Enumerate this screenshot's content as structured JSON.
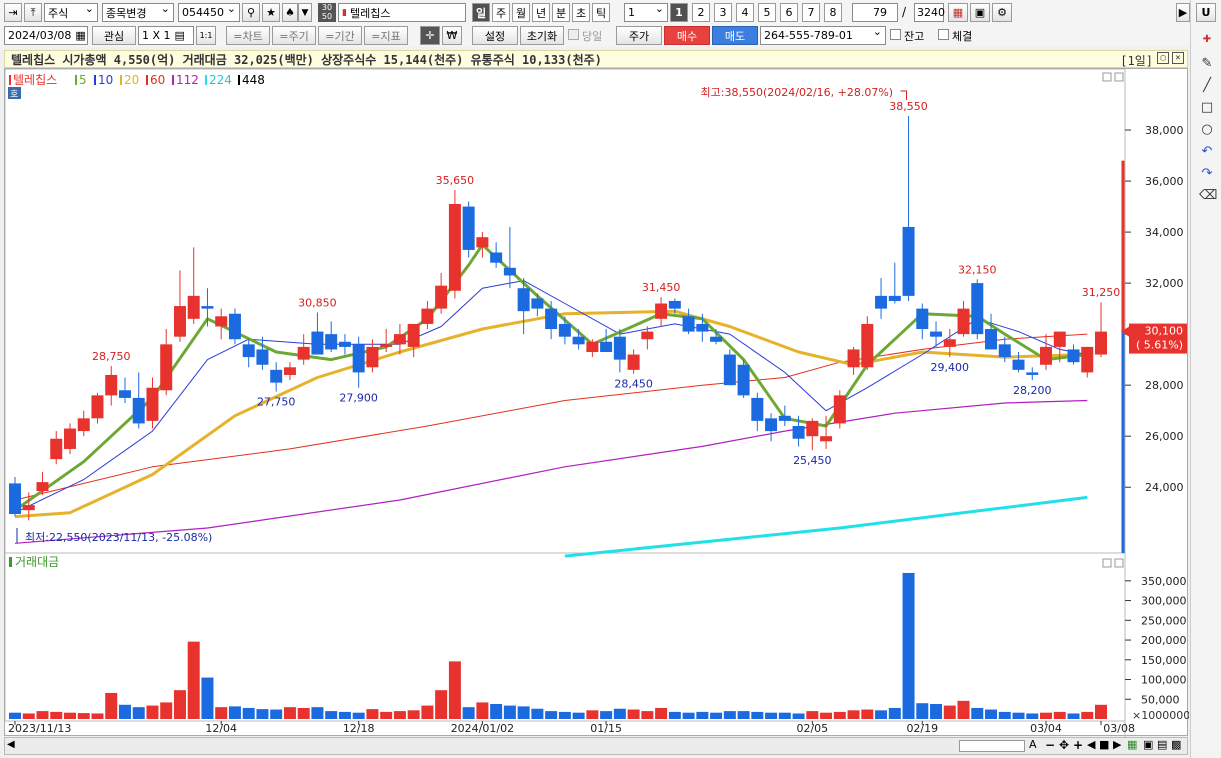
{
  "toolbar1": {
    "market": "주식",
    "change_label": "종목변경",
    "code": "054450",
    "stock_name": "텔레칩스",
    "period_buttons": [
      "일",
      "주",
      "월",
      "년",
      "분",
      "초",
      "틱"
    ],
    "interval_value": "1",
    "num_buttons": [
      "1",
      "2",
      "3",
      "4",
      "5",
      "6",
      "7",
      "8"
    ],
    "view_count": "79",
    "slash": "/",
    "total_count": "3240",
    "code_badge": "30\n50"
  },
  "toolbar2": {
    "date": "2024/03/08",
    "watch_label": "관심",
    "layout_label": "1 X 1",
    "chart_label": "=차트",
    "cycle_label": "=주기",
    "range_label": "=기간",
    "indicator_label": "=지표",
    "settings_label": "설정",
    "reset_label": "초기화",
    "today_label": "당일",
    "price_label": "주가",
    "buy_label": "매수",
    "sell_label": "매도",
    "account": "264-555-789-01",
    "balance_label": "잔고",
    "fill_label": "체결",
    "won_label": "₩"
  },
  "info_bar": {
    "text": "텔레칩스  시가총액 4,550(억)  거래대금 32,025(백만)  상장주식수 15,144(천주)  유통주식 10,133(천주)",
    "window_label": "[1일]"
  },
  "legend": {
    "name": "텔레칩스",
    "items": [
      {
        "label": "5",
        "color": "#6ea834"
      },
      {
        "label": "10",
        "color": "#2a3ad8"
      },
      {
        "label": "20",
        "color": "#e6b22a"
      },
      {
        "label": "60",
        "color": "#e0301e"
      },
      {
        "label": "112",
        "color": "#b020c0"
      },
      {
        "label": "224",
        "color": "#20e0e8"
      },
      {
        "label": "448",
        "color": "#000000"
      }
    ],
    "small_tag": "호"
  },
  "annotations": {
    "high": "최고:38,550(2024/02/16, +28.07%)",
    "low": "최저:22,550(2023/11/13, -25.08%)",
    "current_price": "30,100",
    "current_change": "( 5.61%)",
    "volume_title": "거래대금",
    "volume_unit": "×1000000"
  },
  "chart_data": {
    "type": "candlestick",
    "candles": [
      {
        "d": "2023/11/13",
        "o": 24150,
        "h": 24400,
        "l": 22850,
        "c": 22950
      },
      {
        "d": "2023/11/14",
        "o": 23100,
        "h": 23800,
        "l": 22700,
        "c": 23300
      },
      {
        "d": "2023/11/15",
        "o": 23850,
        "h": 24600,
        "l": 23700,
        "c": 24200
      },
      {
        "d": "2023/11/16",
        "o": 25100,
        "h": 26200,
        "l": 24900,
        "c": 25900
      },
      {
        "d": "2023/11/17",
        "o": 25500,
        "h": 26500,
        "l": 25300,
        "c": 26300
      },
      {
        "d": "2023/11/20",
        "o": 26200,
        "h": 27000,
        "l": 26000,
        "c": 26700
      },
      {
        "d": "2023/11/21",
        "o": 26700,
        "h": 27700,
        "l": 26500,
        "c": 27600
      },
      {
        "d": "2023/11/22",
        "o": 27600,
        "h": 28750,
        "l": 27200,
        "c": 28400
      },
      {
        "d": "2023/11/23",
        "o": 27800,
        "h": 28300,
        "l": 27300,
        "c": 27500
      },
      {
        "d": "2023/11/24",
        "o": 27500,
        "h": 28500,
        "l": 26300,
        "c": 26500
      },
      {
        "d": "2023/11/27",
        "o": 26600,
        "h": 28300,
        "l": 26300,
        "c": 27900
      },
      {
        "d": "2023/11/28",
        "o": 27800,
        "h": 30200,
        "l": 27600,
        "c": 29600
      },
      {
        "d": "2023/11/29",
        "o": 29900,
        "h": 32500,
        "l": 29700,
        "c": 31100
      },
      {
        "d": "2023/11/30",
        "o": 30600,
        "h": 33400,
        "l": 30400,
        "c": 31500
      },
      {
        "d": "2023/12/01",
        "o": 31100,
        "h": 31800,
        "l": 30300,
        "c": 31000
      },
      {
        "d": "2023/12/04",
        "o": 30300,
        "h": 31000,
        "l": 29800,
        "c": 30700
      },
      {
        "d": "2023/12/05",
        "o": 30800,
        "h": 31000,
        "l": 29600,
        "c": 29800
      },
      {
        "d": "2023/12/06",
        "o": 29600,
        "h": 29800,
        "l": 28700,
        "c": 29100
      },
      {
        "d": "2023/12/07",
        "o": 29400,
        "h": 29900,
        "l": 28600,
        "c": 28800
      },
      {
        "d": "2023/12/08",
        "o": 28600,
        "h": 28900,
        "l": 27750,
        "c": 28100
      },
      {
        "d": "2023/12/11",
        "o": 28400,
        "h": 28900,
        "l": 28200,
        "c": 28700
      },
      {
        "d": "2023/12/12",
        "o": 29000,
        "h": 30000,
        "l": 28800,
        "c": 29500
      },
      {
        "d": "2023/12/13",
        "o": 30100,
        "h": 30850,
        "l": 29200,
        "c": 29200
      },
      {
        "d": "2023/12/14",
        "o": 30000,
        "h": 30500,
        "l": 29300,
        "c": 29400
      },
      {
        "d": "2023/12/15",
        "o": 29700,
        "h": 30000,
        "l": 29200,
        "c": 29500
      },
      {
        "d": "2023/12/18",
        "o": 29600,
        "h": 29900,
        "l": 27900,
        "c": 28500
      },
      {
        "d": "2023/12/19",
        "o": 28700,
        "h": 29800,
        "l": 28500,
        "c": 29500
      },
      {
        "d": "2023/12/20",
        "o": 29500,
        "h": 30200,
        "l": 29300,
        "c": 29600
      },
      {
        "d": "2023/12/21",
        "o": 29600,
        "h": 30400,
        "l": 29200,
        "c": 30000
      },
      {
        "d": "2023/12/22",
        "o": 29500,
        "h": 30100,
        "l": 29100,
        "c": 30400
      },
      {
        "d": "2023/12/26",
        "o": 30400,
        "h": 31300,
        "l": 30200,
        "c": 31000
      },
      {
        "d": "2023/12/27",
        "o": 31000,
        "h": 32400,
        "l": 30800,
        "c": 31900
      },
      {
        "d": "2023/12/28",
        "o": 31700,
        "h": 35650,
        "l": 31400,
        "c": 35100
      },
      {
        "d": "2023/12/29",
        "o": 35000,
        "h": 35200,
        "l": 33000,
        "c": 33300
      },
      {
        "d": "2024/01/02",
        "o": 33400,
        "h": 34000,
        "l": 33000,
        "c": 33800
      },
      {
        "d": "2024/01/03",
        "o": 33200,
        "h": 33600,
        "l": 32600,
        "c": 32800
      },
      {
        "d": "2024/01/04",
        "o": 32600,
        "h": 34200,
        "l": 31800,
        "c": 32300
      },
      {
        "d": "2024/01/05",
        "o": 31800,
        "h": 32200,
        "l": 30000,
        "c": 30900
      },
      {
        "d": "2024/01/08",
        "o": 31400,
        "h": 31600,
        "l": 30700,
        "c": 31000
      },
      {
        "d": "2024/01/09",
        "o": 31000,
        "h": 31300,
        "l": 29800,
        "c": 30200
      },
      {
        "d": "2024/01/10",
        "o": 30400,
        "h": 30700,
        "l": 29600,
        "c": 29900
      },
      {
        "d": "2024/01/11",
        "o": 29900,
        "h": 30200,
        "l": 29400,
        "c": 29600
      },
      {
        "d": "2024/01/12",
        "o": 29300,
        "h": 29800,
        "l": 29100,
        "c": 29700
      },
      {
        "d": "2024/01/15",
        "o": 29700,
        "h": 30200,
        "l": 29300,
        "c": 29300
      },
      {
        "d": "2024/01/16",
        "o": 29900,
        "h": 30200,
        "l": 28500,
        "c": 29000
      },
      {
        "d": "2024/01/17",
        "o": 28600,
        "h": 29400,
        "l": 28450,
        "c": 29200
      },
      {
        "d": "2024/01/18",
        "o": 29800,
        "h": 30300,
        "l": 29400,
        "c": 30100
      },
      {
        "d": "2024/01/19",
        "o": 30600,
        "h": 31450,
        "l": 30300,
        "c": 31200
      },
      {
        "d": "2024/01/22",
        "o": 31300,
        "h": 31400,
        "l": 30800,
        "c": 31000
      },
      {
        "d": "2024/01/23",
        "o": 30700,
        "h": 31000,
        "l": 30000,
        "c": 30100
      },
      {
        "d": "2024/01/24",
        "o": 30400,
        "h": 30800,
        "l": 29700,
        "c": 30100
      },
      {
        "d": "2024/01/25",
        "o": 29900,
        "h": 30200,
        "l": 29600,
        "c": 29700
      },
      {
        "d": "2024/01/26",
        "o": 29200,
        "h": 29400,
        "l": 28100,
        "c": 28000
      },
      {
        "d": "2024/01/29",
        "o": 28800,
        "h": 29000,
        "l": 27500,
        "c": 27600
      },
      {
        "d": "2024/01/30",
        "o": 27500,
        "h": 27700,
        "l": 26200,
        "c": 26600
      },
      {
        "d": "2024/01/31",
        "o": 26700,
        "h": 26900,
        "l": 25800,
        "c": 26200
      },
      {
        "d": "2024/02/01",
        "o": 26800,
        "h": 27200,
        "l": 26400,
        "c": 26600
      },
      {
        "d": "2024/02/02",
        "o": 26400,
        "h": 26800,
        "l": 25600,
        "c": 25900
      },
      {
        "d": "2024/02/05",
        "o": 26000,
        "h": 26700,
        "l": 25450,
        "c": 26600
      },
      {
        "d": "2024/02/06",
        "o": 25800,
        "h": 26800,
        "l": 25500,
        "c": 26000
      },
      {
        "d": "2024/02/07",
        "o": 26500,
        "h": 27800,
        "l": 26300,
        "c": 27600
      },
      {
        "d": "2024/02/08",
        "o": 28700,
        "h": 29500,
        "l": 28400,
        "c": 29400
      },
      {
        "d": "2024/02/13",
        "o": 28700,
        "h": 30700,
        "l": 28600,
        "c": 30400
      },
      {
        "d": "2024/02/14",
        "o": 31500,
        "h": 32200,
        "l": 30600,
        "c": 31000
      },
      {
        "d": "2024/02/15",
        "o": 31500,
        "h": 32800,
        "l": 31200,
        "c": 31300
      },
      {
        "d": "2024/02/16",
        "o": 34200,
        "h": 38550,
        "l": 31300,
        "c": 31500
      },
      {
        "d": "2024/02/19",
        "o": 31000,
        "h": 31200,
        "l": 29800,
        "c": 30200
      },
      {
        "d": "2024/02/20",
        "o": 30100,
        "h": 30500,
        "l": 29500,
        "c": 29900
      },
      {
        "d": "2024/02/21",
        "o": 29500,
        "h": 30200,
        "l": 29100,
        "c": 29800
      },
      {
        "d": "2024/02/22",
        "o": 30000,
        "h": 31300,
        "l": 29900,
        "c": 31000
      },
      {
        "d": "2024/02/23",
        "o": 32000,
        "h": 32150,
        "l": 29800,
        "c": 30000
      },
      {
        "d": "2024/02/26",
        "o": 30200,
        "h": 30800,
        "l": 29400,
        "c": 29400
      },
      {
        "d": "2024/02/27",
        "o": 29600,
        "h": 29900,
        "l": 28900,
        "c": 29100
      },
      {
        "d": "2024/02/28",
        "o": 29000,
        "h": 29300,
        "l": 28500,
        "c": 28600
      },
      {
        "d": "2024/02/29",
        "o": 28500,
        "h": 28700,
        "l": 28200,
        "c": 28400
      },
      {
        "d": "2024/03/04",
        "o": 28800,
        "h": 30000,
        "l": 28600,
        "c": 29500
      },
      {
        "d": "2024/03/05",
        "o": 29500,
        "h": 29700,
        "l": 28900,
        "c": 30100
      },
      {
        "d": "2024/03/06",
        "o": 29400,
        "h": 29600,
        "l": 28800,
        "c": 28900
      },
      {
        "d": "2024/03/07",
        "o": 28500,
        "h": 29500,
        "l": 28300,
        "c": 29500
      },
      {
        "d": "2024/03/08",
        "o": 29200,
        "h": 31250,
        "l": 29100,
        "c": 30100
      }
    ],
    "volume": [
      16,
      14,
      20,
      18,
      16,
      15,
      14,
      66,
      36,
      30,
      34,
      42,
      73,
      196,
      105,
      30,
      32,
      28,
      25,
      24,
      30,
      28,
      30,
      20,
      18,
      16,
      25,
      18,
      20,
      22,
      34,
      73,
      146,
      30,
      42,
      38,
      34,
      32,
      26,
      20,
      18,
      16,
      22,
      20,
      26,
      24,
      20,
      28,
      18,
      16,
      18,
      16,
      20,
      20,
      18,
      16,
      16,
      14,
      20,
      16,
      18,
      22,
      24,
      22,
      28,
      370,
      40,
      38,
      34,
      46,
      28,
      24,
      18,
      16,
      14,
      16,
      18,
      14,
      18,
      36
    ],
    "ma_series": {
      "ma5": [
        [
          0,
          23100
        ],
        [
          5,
          25000
        ],
        [
          10,
          27500
        ],
        [
          14,
          30600
        ],
        [
          19,
          29300
        ],
        [
          23,
          29000
        ],
        [
          27,
          29500
        ],
        [
          30,
          30600
        ],
        [
          33,
          32700
        ],
        [
          34,
          33500
        ],
        [
          38,
          31500
        ],
        [
          42,
          29600
        ],
        [
          47,
          30800
        ],
        [
          50,
          30600
        ],
        [
          53,
          29000
        ],
        [
          56,
          26700
        ],
        [
          59,
          26400
        ],
        [
          62,
          28800
        ],
        [
          66,
          30800
        ],
        [
          70,
          30700
        ],
        [
          72,
          30000
        ],
        [
          75,
          29000
        ],
        [
          78,
          29200
        ]
      ],
      "ma10": [
        [
          0,
          23000
        ],
        [
          5,
          24300
        ],
        [
          10,
          26200
        ],
        [
          14,
          29000
        ],
        [
          17,
          29800
        ],
        [
          22,
          29600
        ],
        [
          28,
          29600
        ],
        [
          31,
          30300
        ],
        [
          34,
          31800
        ],
        [
          37,
          32100
        ],
        [
          40,
          31200
        ],
        [
          44,
          30000
        ],
        [
          48,
          30400
        ],
        [
          52,
          30000
        ],
        [
          56,
          28500
        ],
        [
          59,
          27000
        ],
        [
          62,
          27900
        ],
        [
          66,
          29200
        ],
        [
          70,
          30600
        ],
        [
          73,
          30100
        ],
        [
          76,
          29400
        ],
        [
          78,
          29200
        ]
      ],
      "ma20": [
        [
          0,
          22850
        ],
        [
          4,
          23000
        ],
        [
          10,
          24500
        ],
        [
          16,
          26800
        ],
        [
          22,
          28300
        ],
        [
          28,
          29300
        ],
        [
          34,
          30200
        ],
        [
          40,
          30800
        ],
        [
          48,
          30900
        ],
        [
          52,
          30300
        ],
        [
          57,
          29300
        ],
        [
          61,
          28800
        ],
        [
          66,
          29300
        ],
        [
          72,
          29100
        ],
        [
          78,
          29200
        ]
      ],
      "ma60": [
        [
          0,
          23500
        ],
        [
          10,
          24800
        ],
        [
          20,
          25500
        ],
        [
          30,
          26400
        ],
        [
          40,
          27400
        ],
        [
          50,
          28000
        ],
        [
          56,
          28300
        ],
        [
          60,
          28900
        ],
        [
          66,
          29400
        ],
        [
          72,
          29800
        ],
        [
          78,
          30000
        ]
      ],
      "ma112": [
        [
          0,
          21800
        ],
        [
          14,
          22400
        ],
        [
          28,
          23500
        ],
        [
          40,
          24800
        ],
        [
          50,
          25600
        ],
        [
          56,
          26200
        ],
        [
          64,
          26900
        ],
        [
          72,
          27300
        ],
        [
          78,
          27400
        ]
      ],
      "ma224": [
        [
          40,
          21300
        ],
        [
          60,
          22400
        ],
        [
          78,
          23600
        ]
      ]
    },
    "price_axis": {
      "min": 21500,
      "max": 40000,
      "ticks": [
        "38,000",
        "36,000",
        "34,000",
        "32,000",
        "30,000",
        "28,000",
        "26,000",
        "24,000"
      ],
      "tick_values": [
        38000,
        36000,
        34000,
        32000,
        30000,
        28000,
        26000,
        24000
      ]
    },
    "volume_axis": {
      "max": 380,
      "ticks": [
        "350,000",
        "300,000",
        "250,000",
        "200,000",
        "150,000",
        "100,000",
        "50,000"
      ],
      "tick_values": [
        350,
        300,
        250,
        200,
        150,
        100,
        50
      ]
    },
    "x_labels": [
      {
        "i": 0,
        "label": "2023/11/13"
      },
      {
        "i": 15,
        "label": "12/04"
      },
      {
        "i": 25,
        "label": "12/18"
      },
      {
        "i": 34,
        "label": "2024/01/02"
      },
      {
        "i": 43,
        "label": "01/15"
      },
      {
        "i": 58,
        "label": "02/05"
      },
      {
        "i": 66,
        "label": "02/19"
      },
      {
        "i": 75,
        "label": "03/04"
      },
      {
        "i": 79,
        "label": "03/08"
      }
    ],
    "price_labels": [
      {
        "i": 7,
        "label": "28,750",
        "pos": "high",
        "color": "#d42020"
      },
      {
        "i": 22,
        "label": "30,850",
        "pos": "high",
        "color": "#d42020"
      },
      {
        "i": 32,
        "label": "35,650",
        "pos": "high",
        "color": "#d42020"
      },
      {
        "i": 47,
        "label": "31,450",
        "pos": "high",
        "color": "#d42020"
      },
      {
        "i": 65,
        "label": "38,550",
        "pos": "high",
        "color": "#d42020"
      },
      {
        "i": 70,
        "label": "32,150",
        "pos": "high",
        "color": "#d42020"
      },
      {
        "i": 79,
        "label": "31,250",
        "pos": "high",
        "color": "#d42020"
      },
      {
        "i": 19,
        "label": "27,750",
        "pos": "low",
        "color": "#1a2aa8"
      },
      {
        "i": 25,
        "label": "27,900",
        "pos": "low",
        "color": "#1a2aa8"
      },
      {
        "i": 45,
        "label": "28,450",
        "pos": "low",
        "color": "#1a2aa8"
      },
      {
        "i": 58,
        "label": "25,450",
        "pos": "low",
        "color": "#1a2aa8"
      },
      {
        "i": 68,
        "label": "29,400",
        "pos": "low",
        "color": "#1a2aa8"
      },
      {
        "i": 74,
        "label": "28,200",
        "pos": "low",
        "color": "#1a2aa8"
      }
    ],
    "up_color": "#e8322e",
    "down_color": "#1c6ae0"
  }
}
